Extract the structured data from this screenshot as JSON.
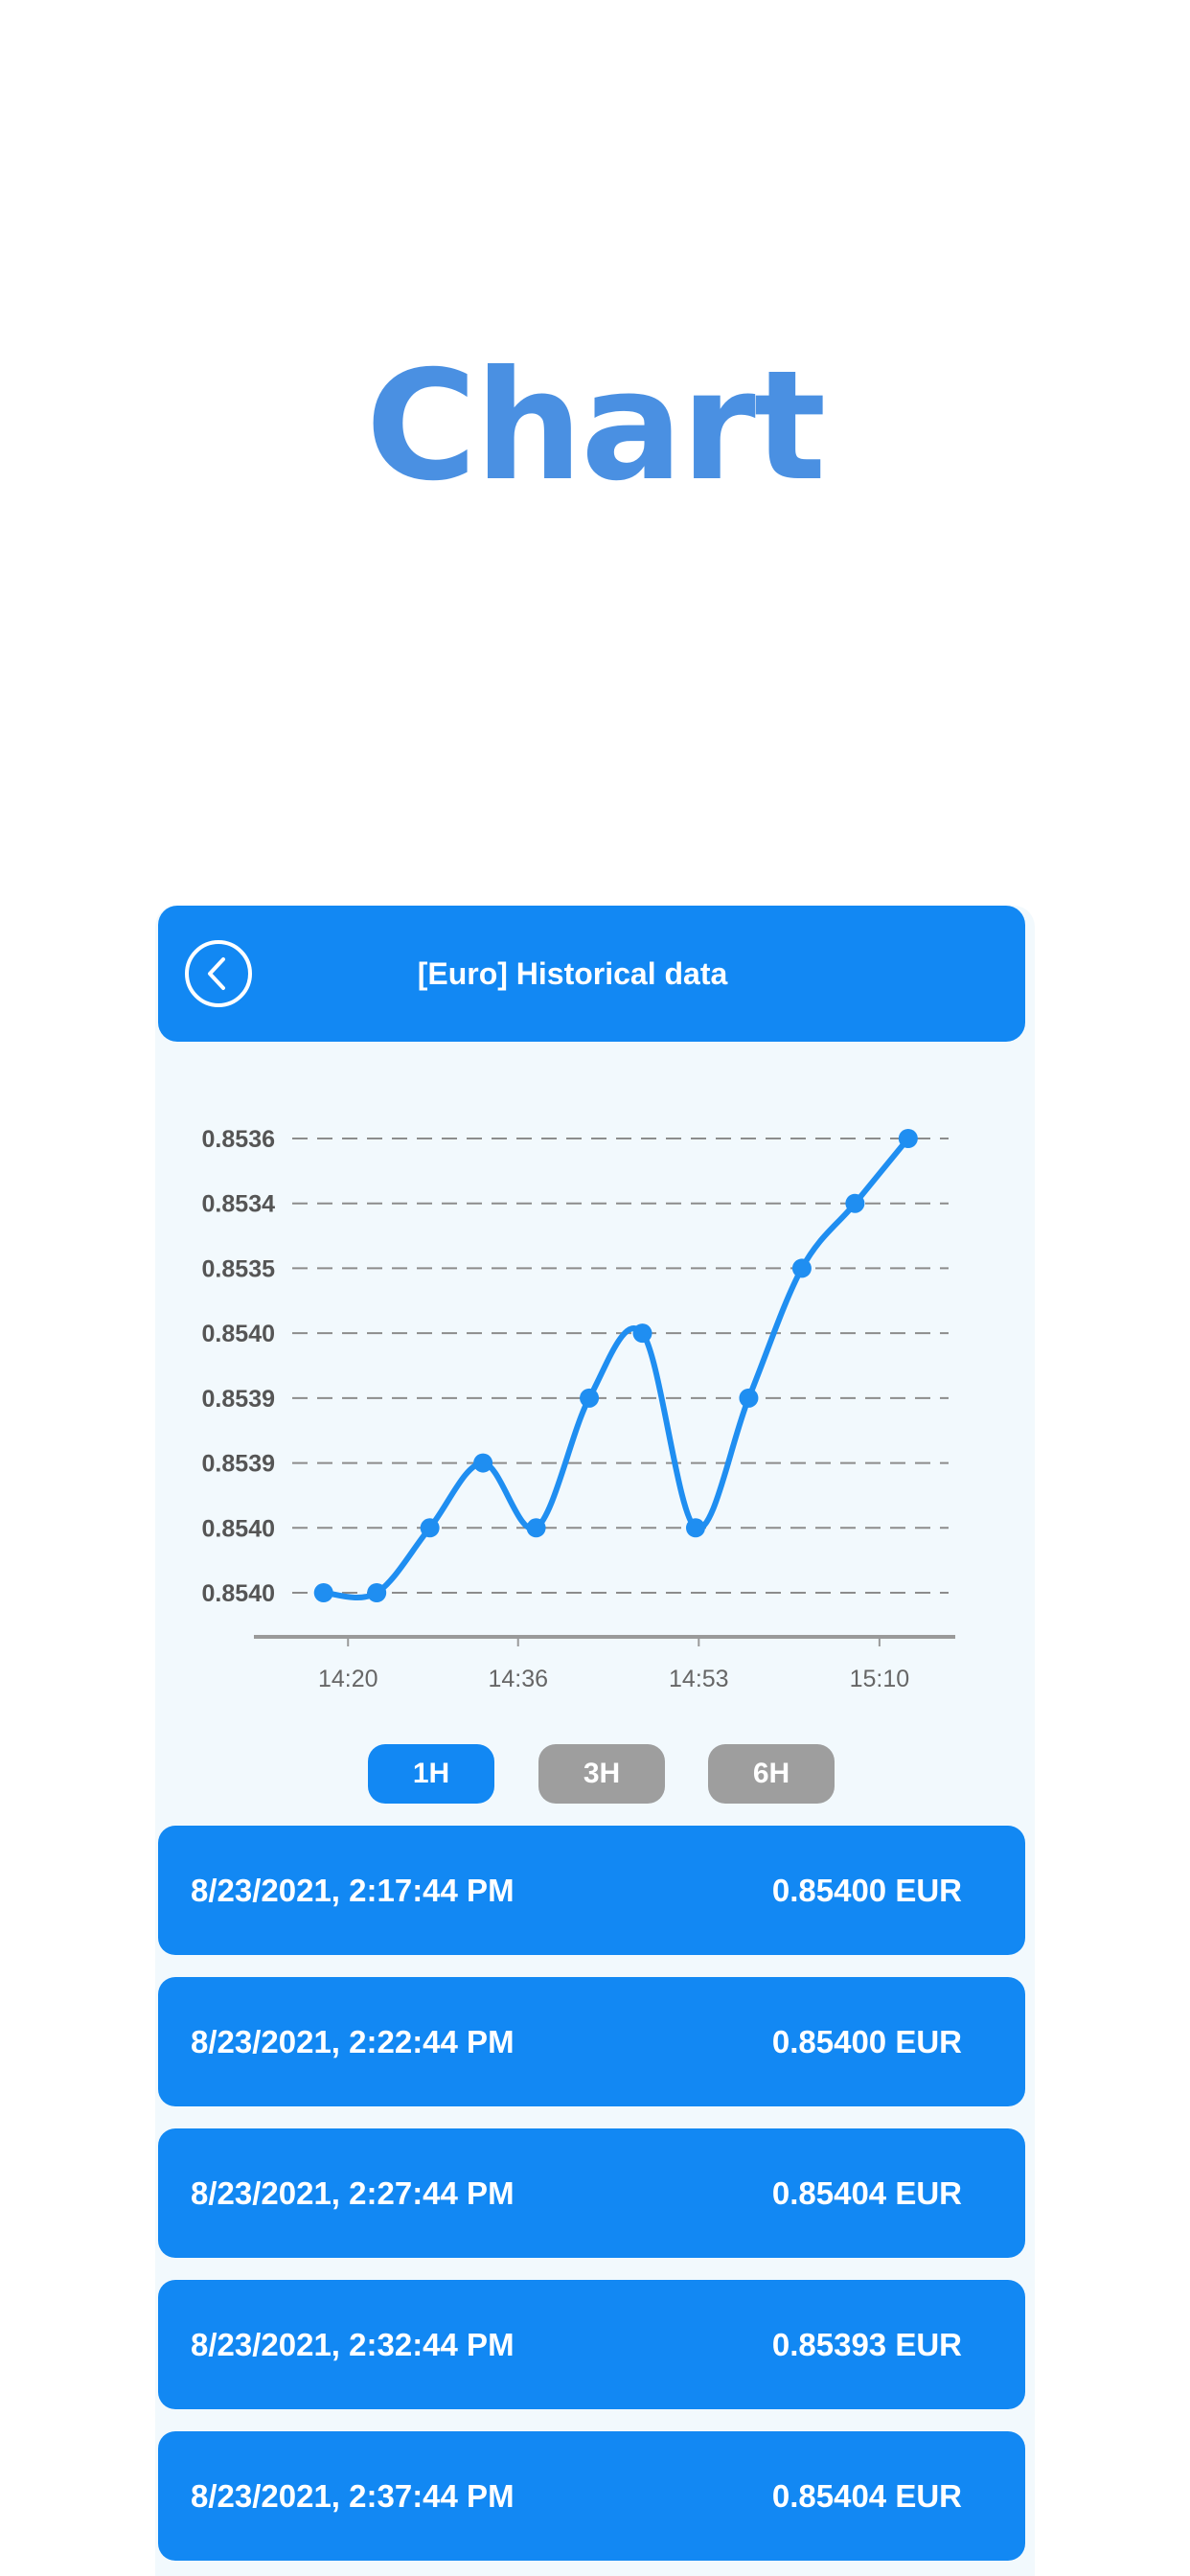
{
  "page_title": "Chart",
  "header": {
    "title": "[Euro] Historical data",
    "back_icon": "chevron-left-circle-icon"
  },
  "colors": {
    "accent": "#1288f3",
    "title": "#4a90e2",
    "inactive": "#9e9e9e",
    "background": "#f2f9fd"
  },
  "chart_data": {
    "type": "line",
    "y_tick_labels": [
      "0.8536",
      "0.8534",
      "0.8535",
      "0.8540",
      "0.8539",
      "0.8539",
      "0.8540",
      "0.8540"
    ],
    "x_tick_labels": [
      "14:20",
      "14:36",
      "14:53",
      "15:10"
    ],
    "x_ticks_minutes": [
      20,
      36,
      53,
      70
    ],
    "points": [
      {
        "x": 17.7,
        "level": 0
      },
      {
        "x": 22.7,
        "level": 0
      },
      {
        "x": 27.7,
        "level": 1
      },
      {
        "x": 32.7,
        "level": 2
      },
      {
        "x": 37.7,
        "level": 1
      },
      {
        "x": 42.7,
        "level": 3
      },
      {
        "x": 47.7,
        "level": 4
      },
      {
        "x": 52.7,
        "level": 1
      },
      {
        "x": 57.7,
        "level": 3
      },
      {
        "x": 62.7,
        "level": 5
      },
      {
        "x": 67.7,
        "level": 6
      },
      {
        "x": 72.7,
        "level": 7
      }
    ],
    "grid": true,
    "line_color": "#1f8ef1"
  },
  "range_buttons": [
    {
      "label": "1H",
      "active": true
    },
    {
      "label": "3H",
      "active": false
    },
    {
      "label": "6H",
      "active": false
    }
  ],
  "history": [
    {
      "time": "8/23/2021, 2:17:44 PM",
      "value": "0.85400 EUR"
    },
    {
      "time": "8/23/2021, 2:22:44 PM",
      "value": "0.85400 EUR"
    },
    {
      "time": "8/23/2021, 2:27:44 PM",
      "value": "0.85404 EUR"
    },
    {
      "time": "8/23/2021, 2:32:44 PM",
      "value": "0.85393 EUR"
    },
    {
      "time": "8/23/2021, 2:37:44 PM",
      "value": "0.85404 EUR"
    }
  ]
}
